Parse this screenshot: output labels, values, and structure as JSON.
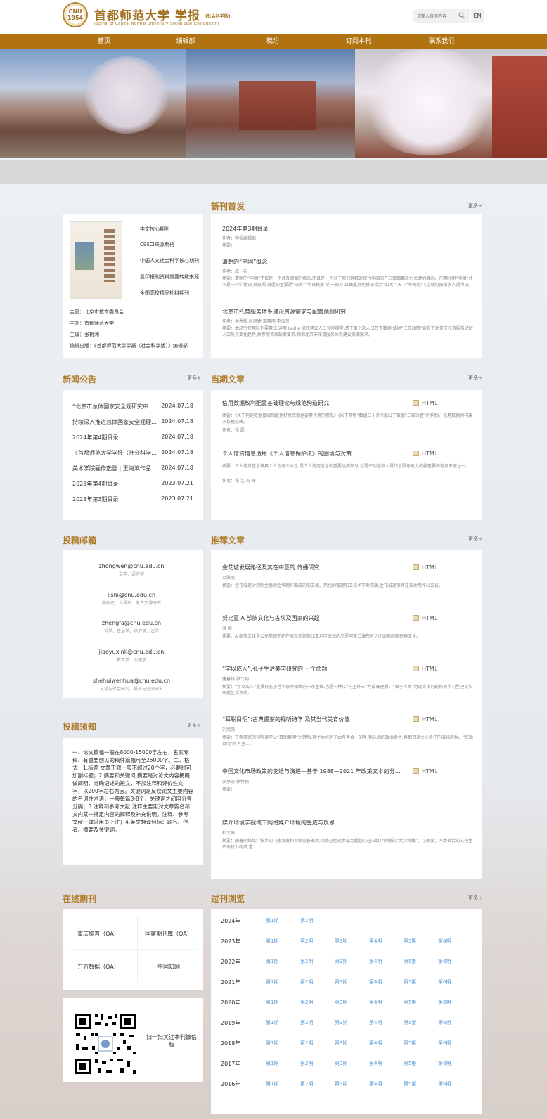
{
  "header": {
    "seal_text": "CNU\n1954",
    "title_cn": "首都师范大学 学报",
    "title_cn_sub": "(社会科学版)",
    "title_en": "Journal of Capital Normal University(Social Sciences Edition)",
    "search_placeholder": "请输入搜索内容",
    "lang": "EN"
  },
  "nav": [
    "首页",
    "编辑部",
    "稿约",
    "订阅本刊",
    "联系我们"
  ],
  "new_release": {
    "title": "新刊首发",
    "more": "更多+",
    "journal_info": [
      "中文核心期刊",
      "CSSCI来源期刊",
      "中国人文社会科学核心期刊",
      "复印报刊资料重要转载来源",
      "全国高校精品社科期刊"
    ],
    "meta": [
      "主管：北京市教育委员会",
      "主办：首都师范大学",
      "主编：张桃洲",
      "编辑出版：《首都师范大学学报（社会科学版）》编辑部"
    ],
    "articles": [
      {
        "title": "2024年第3期目录",
        "author": "作者：学报编辑部",
        "abstract": "摘要："
      },
      {
        "title": "清朝的“中国”概念",
        "author": "作者：成一农",
        "abstract": "摘要：清朝的“中国”不仅是一个涉及清朝的概念,而且是一个对于我们理解近现代中国的方方面面都极为关键的概念。在明时期“中国”并不是一个中性词,其原因,首倡的主要是“四夷”“华夷秩序”的一部分,且由此其也就被视为“四夷”“天下”等概念中,这就也被很多人视为误。"
      },
      {
        "title": "北京市托育服务体系建设资源需求与配置预测研究",
        "author": "作者：洪秀敏 赵思婕 邢晓丽 李仪贝",
        "abstract": "摘要：本研究使用队列要素法,运用 Leslie 矩阵建立人口预测模型,基于第七次人口普查数据,依据“三孩政策”背景下北京市托育服务适龄人口及其变化趋势,并参照相关政策要求,预测北京市托育服务体系建设资源需求。"
      }
    ]
  },
  "news": {
    "title": "新闻公告",
    "more": "更多+",
    "items": [
      {
        "t": "“北京市总体国家安全观研究中…",
        "d": "2024.07.18"
      },
      {
        "t": "持续深入推进总体国家安全观理…",
        "d": "2024.07.18"
      },
      {
        "t": "2024年第4期目录",
        "d": "2024.07.18"
      },
      {
        "t": "《首都师范大学学报（社会科学…",
        "d": "2024.07.18"
      },
      {
        "t": "美术学院画作选登 | 王海滨作品",
        "d": "2024.07.18"
      },
      {
        "t": "2023年第4期目录",
        "d": "2023.07.21"
      },
      {
        "t": "2023年第3期目录",
        "d": "2023.07.21"
      }
    ]
  },
  "current": {
    "title": "当期文章",
    "more": "更多+",
    "html_label": "HTML",
    "articles": [
      {
        "title": "信用数据权利配置基础理论与规范构造研究",
        "abstract": "摘要：《关于构建数据基础制度更好发挥数据要素作用的意见》(以下简称“数据二十条”)提出了数据“三权分置”的构想。信用数据同样属于数据范畴。",
        "author": "作者：张 磊"
      },
      {
        "title": "个人信贷信息适用《个人信息保护法》的困境与对策",
        "abstract": "摘要：个人信贷信息兼具个人性与公共性,是个人信用信息的重要组成部分,也是评判借款人履约意愿与能力的最重要的信息来源之一。",
        "author": "作者：张 艺 冯 辉"
      }
    ]
  },
  "mailbox": {
    "title": "投稿邮箱",
    "items": [
      {
        "email": "zhongwen@cnu.edu.cn",
        "scope": "文学、语言学"
      },
      {
        "email": "lishi@cnu.edu.cn",
        "scope": "中国史、世界史、考古文博研究"
      },
      {
        "email": "zhengfa@cnu.edu.cn",
        "scope": "哲学、政治学、经济学、法学"
      },
      {
        "email": "jiaoyuxinli@cnu.edu.cn",
        "scope": "教育学、心理学"
      },
      {
        "email": "shehuiwenhua@cnu.edu.cn",
        "scope": "文化与社会研究、城市与空间研究"
      }
    ]
  },
  "recommend": {
    "title": "推荐文章",
    "more": "更多+",
    "html_label": "HTML",
    "articles": [
      {
        "title": "金花城发展路径及其在中亚的 传播研究",
        "author": "吕雅丽",
        "abstract": "摘要：金花城是对用制金器的金块制作而成的加工模。两代的管理加工技术不断精高,金花城逐渐传往各地用作公文钱。"
      },
      {
        "title": "努比亚 A 部族文化与古埃及国家的兴起",
        "author": "温 静",
        "abstract": "摘要：A 部族文化是公元前四千纪在埃及南部努比亚地区出现的尼罗河第二瀑布区之间出现的新石器文化。"
      },
      {
        "title": "“学以成人”:孔子生活美学研究的 一个命题",
        "author": "唐善林 张飞翔",
        "abstract": "摘要：“学以成人”是贯穿孔子哲学思考始终的一条主线,也是一种以“内圣外王”为最高理想、“君子人格”为现实指向的修身学习型理论和审美生活方式。"
      },
      {
        "title": "“耳聪目明”:古典儒家的视听诗学 及其当代美育价值",
        "author": "刘旭强",
        "abstract": "摘要：古典儒家的视听诗学以“耳聪目明”为理想,其主体经历了由至善合一的圣,到入间的政治君主,再到普通士人君子的演化历程。“耳聪目明”具有主…"
      },
      {
        "title": "中国文化市场政策的变迁与演进—基于 1988—2021 年政策文本的分…",
        "author": "吴承忠 徐竹楠",
        "abstract": "摘要："
      },
      {
        "title": "媒介环境学视域下网络媒介环境的生成与反思",
        "author": "杜文峰",
        "abstract": "摘要：随着网络媒介技术的飞速发展和不断完善革新,网络已经逐步成为超越以往旧媒介的新的“大众传媒”。它改变了人类社会的文化生产与权力构成,重…"
      }
    ]
  },
  "notice": {
    "title": "投稿须知",
    "more": "更多+",
    "text": "一、论文篇幅一般在8000-15000字左右，名家专稿、有重要创见的稿件篇幅可至25000字。二、格式：1.标题 文章正题一般不超过20个字，必要时可加副标题；2.摘要和关键词 摘要是对论文内容梗概做简明、准确记述的短文，不加注释和评价性文字，以200字左右为宜。关键词是反映论文主要内容的名词性术语，一般每篇3-8个，关键词之间用分号分隔；3.注释和参考文献 注释主要用对文章篇名和文内某一特定内容的解释及补充说明。注释、参考文献一律采用页下注；4.英文翻译包括：题名、作者、摘要及关键词。"
  },
  "online": {
    "title": "在线期刊",
    "items": [
      "重庆维普（OA）",
      "国家期刊库（OA）",
      "万方数据（OA）",
      "中国知网"
    ]
  },
  "qr": {
    "caption": "扫一扫关注本刊微信版"
  },
  "archive": {
    "title": "过刊浏览",
    "more": "更多+",
    "years": [
      {
        "year": "2024年",
        "issues": [
          "第1期",
          "第2期"
        ]
      },
      {
        "year": "2023年",
        "issues": [
          "第1期",
          "第2期",
          "第3期",
          "第4期",
          "第5期",
          "第6期"
        ]
      },
      {
        "year": "2022年",
        "issues": [
          "第1期",
          "第2期",
          "第3期",
          "第4期",
          "第5期",
          "第6期"
        ]
      },
      {
        "year": "2021年",
        "issues": [
          "第1期",
          "第2期",
          "第3期",
          "第4期",
          "第5期",
          "第6期"
        ]
      },
      {
        "year": "2020年",
        "issues": [
          "第1期",
          "第2期",
          "第3期",
          "第4期",
          "第5期",
          "第6期"
        ]
      },
      {
        "year": "2019年",
        "issues": [
          "第1期",
          "第2期",
          "第3期",
          "第4期",
          "第5期",
          "第6期"
        ]
      },
      {
        "year": "2018年",
        "issues": [
          "第1期",
          "第2期",
          "第3期",
          "第4期",
          "第5期",
          "第6期"
        ]
      },
      {
        "year": "2017年",
        "issues": [
          "第1期",
          "第2期",
          "第3期",
          "第4期",
          "第5期",
          "第6期"
        ]
      },
      {
        "year": "2016年",
        "issues": [
          "第1期",
          "第2期",
          "第3期",
          "第4期",
          "第5期",
          "第6期"
        ]
      }
    ]
  }
}
